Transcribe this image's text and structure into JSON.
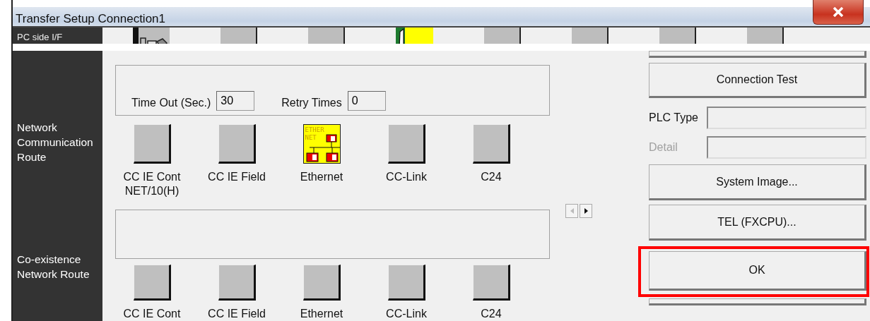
{
  "window": {
    "title": "Transfer Setup Connection1"
  },
  "pc_side_if": {
    "label": "PC side I/F",
    "items": [
      {
        "kind": "pc"
      },
      {
        "kind": "blank"
      },
      {
        "kind": "blank"
      },
      {
        "kind": "board"
      },
      {
        "kind": "blank"
      },
      {
        "kind": "blank"
      },
      {
        "kind": "blank"
      },
      {
        "kind": "blank"
      }
    ]
  },
  "network_route": {
    "label": "Network Communication Route",
    "time_out": {
      "label": "Time Out (Sec.)",
      "value": "30"
    },
    "retry": {
      "label": "Retry Times",
      "value": "0"
    },
    "items": [
      {
        "label": "CC IE Cont NET/10(H)",
        "selected": false
      },
      {
        "label": "CC IE Field",
        "selected": false
      },
      {
        "label": "Ethernet",
        "selected": true,
        "icon_text": [
          "ETHER",
          "NET"
        ]
      },
      {
        "label": "CC-Link",
        "selected": false
      },
      {
        "label": "C24",
        "selected": false
      }
    ]
  },
  "coexistence_route": {
    "label": "Co-existence Network Route",
    "items": [
      {
        "label": "CC IE Cont",
        "selected": false
      },
      {
        "label": "CC IE Field",
        "selected": false
      },
      {
        "label": "Ethernet",
        "selected": false
      },
      {
        "label": "CC-Link",
        "selected": false
      },
      {
        "label": "C24",
        "selected": false
      }
    ]
  },
  "side_panel": {
    "connection_test": "Connection Test",
    "plc_type": {
      "label": "PLC Type"
    },
    "detail": {
      "label": "Detail",
      "disabled": true
    },
    "buttons": [
      {
        "label": "System Image...",
        "highlighted": false
      },
      {
        "label": "TEL (FXCPU)...",
        "highlighted": false
      },
      {
        "label": "OK",
        "highlighted": true
      }
    ]
  }
}
